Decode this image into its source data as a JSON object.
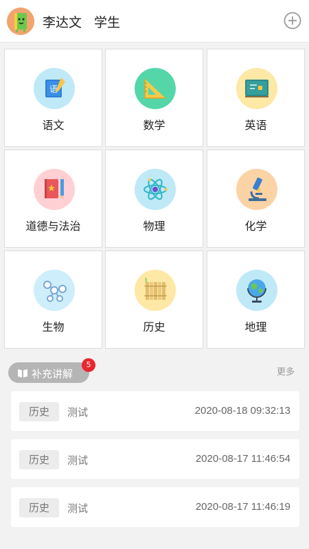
{
  "header": {
    "user_name": "李达文",
    "user_role": "学生",
    "avatar_icon": "notebook-avatar-icon",
    "add_icon": "plus-circle-icon"
  },
  "subjects": [
    {
      "label": "语文",
      "icon": "yuwen-book-icon",
      "bg": "#bfe9f7"
    },
    {
      "label": "数学",
      "icon": "triangle-ruler-icon",
      "bg": "#54d6a8"
    },
    {
      "label": "英语",
      "icon": "blackboard-icon",
      "bg": "#fde8a5"
    },
    {
      "label": "道德与法治",
      "icon": "book-pencil-icon",
      "bg": "#ffd0d3"
    },
    {
      "label": "物理",
      "icon": "atom-icon",
      "bg": "#bfe9f7"
    },
    {
      "label": "化学",
      "icon": "microscope-icon",
      "bg": "#fcd3a5"
    },
    {
      "label": "生物",
      "icon": "molecule-icon",
      "bg": "#cdeefa"
    },
    {
      "label": "历史",
      "icon": "scroll-icon",
      "bg": "#fde8a5"
    },
    {
      "label": "地理",
      "icon": "globe-icon",
      "bg": "#bfe9f7"
    }
  ],
  "supplement": {
    "title": "补充讲解",
    "badge_count": "5",
    "more_label": "更多",
    "icon": "open-book-icon"
  },
  "records": [
    {
      "tag": "历史",
      "title": "测试",
      "time": "2020-08-18 09:32:13"
    },
    {
      "tag": "历史",
      "title": "测试",
      "time": "2020-08-17 11:46:54"
    },
    {
      "tag": "历史",
      "title": "测试",
      "time": "2020-08-17 11:46:19"
    }
  ],
  "colors": {
    "badge": "#e8272f",
    "pill": "#b5b5b5",
    "background": "#f2f2f2"
  }
}
